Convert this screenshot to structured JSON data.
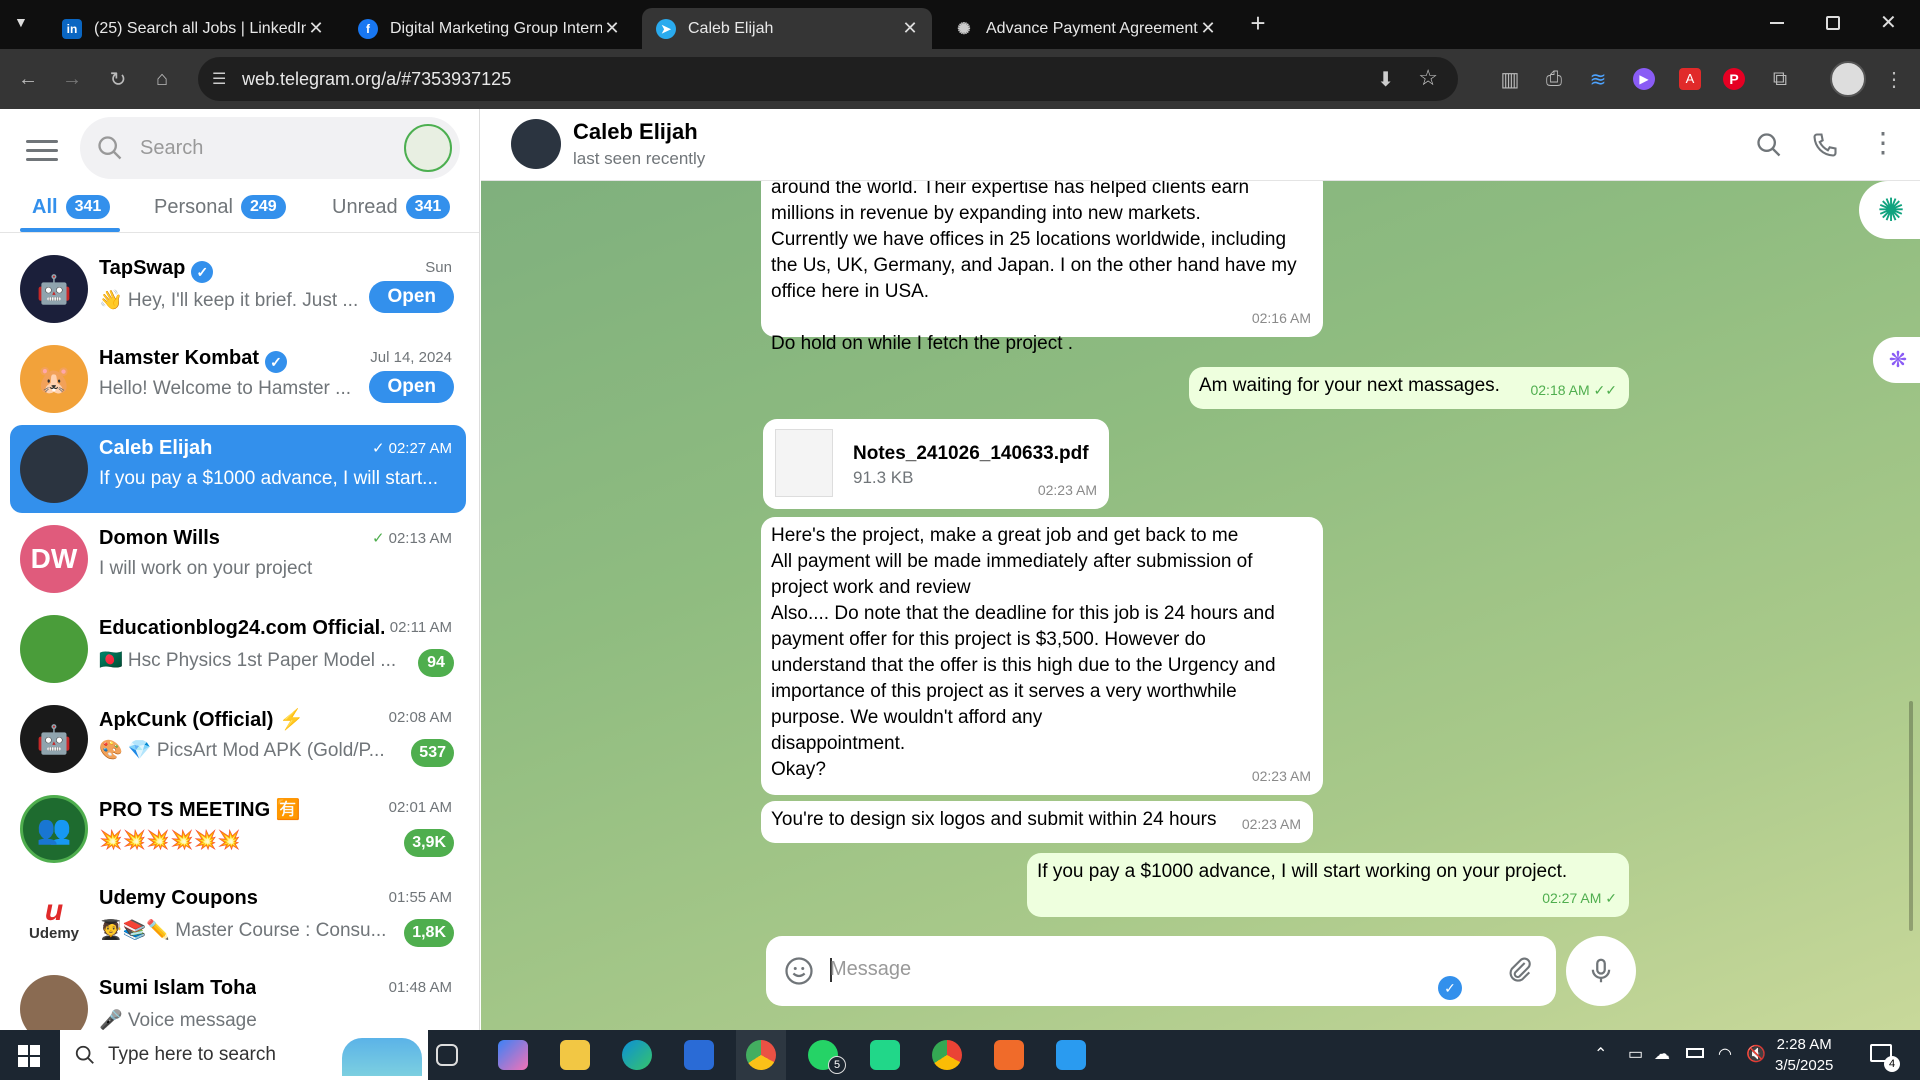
{
  "browser": {
    "tabs": [
      {
        "title": "(25) Search all Jobs | LinkedIn",
        "icon": "linkedin-icon"
      },
      {
        "title": "Digital Marketing Group Interna",
        "icon": "facebook-icon"
      },
      {
        "title": "Caleb Elijah",
        "icon": "telegram-icon"
      },
      {
        "title": "Advance Payment Agreement",
        "icon": "openai-icon"
      }
    ],
    "new_tab_label": "+",
    "url": "web.telegram.org/a/#7353937125"
  },
  "sidebar": {
    "search_placeholder": "Search",
    "folders": [
      {
        "label": "All",
        "count": "341"
      },
      {
        "label": "Personal",
        "count": "249"
      },
      {
        "label": "Unread",
        "count": "341"
      }
    ],
    "chats": [
      {
        "name": "TapSwap",
        "time": "Sun",
        "preview": "👋 Hey, I'll keep it brief. Just ...",
        "action": "Open",
        "avatar_color": "#1b1f3a"
      },
      {
        "name": "Hamster Kombat",
        "time": "Jul 14, 2024",
        "preview": "Hello! Welcome to Hamster ...",
        "action": "Open",
        "avatar_color": "#f2a23a"
      },
      {
        "name": "Caleb Elijah",
        "time": "02:27 AM",
        "preview": "If you pay a $1000 advance, I will start...",
        "avatar_color": "#2b3440"
      },
      {
        "name": "Domon Wills",
        "time": "02:13 AM",
        "preview": "I will work on your project",
        "initials": "DW",
        "avatar_color": "#e05b7c"
      },
      {
        "name": "Educationblog24.com Official...",
        "time": "02:11 AM",
        "preview": "🇧🇩 Hsc Physics 1st Paper Model ...",
        "badge": "94",
        "avatar_color": "#4a9d3a"
      },
      {
        "name": "ApkCunk (Official) ⚡",
        "time": "02:08 AM",
        "preview": "🎨 💎 PicsArt Mod APK (Gold/P...",
        "badge": "537",
        "avatar_color": "#1a1a1a"
      },
      {
        "name": "PRO TS MEETING 🈶",
        "time": "02:01 AM",
        "preview": "💥💥💥💥💥💥",
        "badge": "3,9K",
        "avatar_color": "#1e6b2f"
      },
      {
        "name": "Udemy Coupons",
        "time": "01:55 AM",
        "preview": "🧑‍🎓📚✏️ Master Course : Consu...",
        "badge": "1,8K",
        "avatar_color": "#ffffff",
        "avatar_text": "Udemy"
      },
      {
        "name": "Sumi Islam Toha",
        "time": "01:48 AM",
        "preview": "🎤 Voice message",
        "avatar_color": "#8a6b52"
      }
    ]
  },
  "chat": {
    "name": "Caleb Elijah",
    "status": "last seen recently",
    "messages": [
      {
        "dir": "in",
        "lines": [
          "around the world. Their expertise has helped clients earn",
          "millions in revenue by expanding into new markets.",
          "Currently we have offices in 25 locations worldwide, including",
          "the Us, UK, Germany, and Japan. I on the other hand have my",
          "office here in USA.",
          "",
          "Do hold on while I fetch the project ."
        ],
        "time": "02:16 AM"
      },
      {
        "dir": "out",
        "text": "Am waiting for your next massages.",
        "time": "02:18 AM"
      },
      {
        "dir": "in",
        "file_name": "Notes_241026_140633.pdf",
        "file_size": "91.3 KB",
        "time": "02:23 AM"
      },
      {
        "dir": "in",
        "lines": [
          "Here's the project, make a great job and get back to me",
          "All payment will be made immediately after submission of",
          "project work and review",
          "Also.... Do note that the deadline for this job is 24 hours and",
          "payment offer for this project is $3,500. However do",
          "understand that the offer is this high due to the Urgency and",
          "importance of this project as it serves a very worthwhile",
          "purpose. We wouldn't afford any",
          "disappointment.",
          "Okay?"
        ],
        "time": "02:23 AM"
      },
      {
        "dir": "in",
        "text": "You're to design six logos and submit within 24 hours",
        "time": "02:23 AM"
      },
      {
        "dir": "out",
        "text": "If you pay a $1000 advance, I will start working on your project.",
        "time": "02:27 AM"
      }
    ],
    "composer_placeholder": "Message"
  },
  "taskbar": {
    "search_placeholder": "Type here to search",
    "time": "2:28 AM",
    "date": "3/5/2025",
    "whatsapp_badge": "5",
    "notification_count": "4"
  },
  "colors": {
    "accent": "#3390ec",
    "unread_badge": "#4fae4e",
    "outgoing_bubble": "#eeffde"
  }
}
